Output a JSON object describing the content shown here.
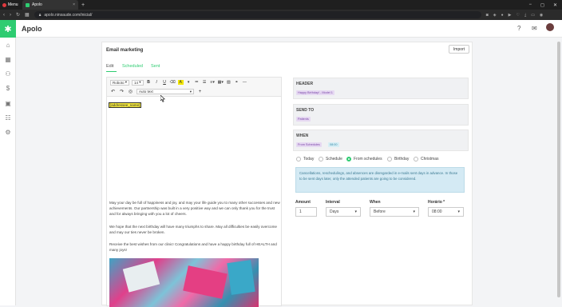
{
  "browser": {
    "menu_label": "Menu",
    "tab_title": "Apolo",
    "tab_close": "×",
    "new_tab": "+",
    "url": "apolo.ninsaude.com/inicial/",
    "window_controls": [
      "−",
      "◻",
      "✕"
    ]
  },
  "app": {
    "name": "Apolo",
    "logo_glyph": "✱",
    "sidebar_items": [
      "home-icon",
      "calendar-icon",
      "patients-icon",
      "finance-icon",
      "marketing-icon",
      "reports-icon",
      "settings-icon"
    ],
    "accent": "#2ecc71"
  },
  "card": {
    "title": "Email marketing",
    "import_label": "Import",
    "tabs": [
      {
        "label": "Edit"
      },
      {
        "label": "Scheduled"
      },
      {
        "label": "Sent"
      }
    ]
  },
  "editor": {
    "font": "Roboto",
    "size": "14",
    "bold": "B",
    "italic": "I",
    "underline": "U",
    "autotext_label": "Auto text",
    "add": "+",
    "placeholder_tag": "[addressee_name]",
    "paragraphs": [
      "May your day be full of happiness and joy, and may your life guide you to many other successes and new achievements. Our partnership was built in a very positive way and we can only thank you for the trust and for always bringing with you a lot of cheers.",
      "We hope that the next birthday will have many triumphs to share. May all difficulties be easily overcome and may our ties never be broken.",
      "Receive the best wishes from our clinic! Congratulations and have a happy birthday full of HEALTH and many joys!"
    ]
  },
  "settings": {
    "header": {
      "title": "HEADER",
      "tag": "Happy Birthday! - Model 1"
    },
    "send_to": {
      "title": "SEND TO",
      "tag": "Patients"
    },
    "when": {
      "title": "WHEN",
      "tag1": "From Schedules",
      "tag2": "08:00"
    },
    "radios": [
      {
        "label": "Today",
        "checked": false
      },
      {
        "label": "Schedule",
        "checked": false
      },
      {
        "label": "From schedules",
        "checked": true
      },
      {
        "label": "Birthday",
        "checked": false
      },
      {
        "label": "Christmas",
        "checked": false
      }
    ],
    "notice": "Cancellations, reschedulings, and absences are disregarded in e-mails sent days in advance. In those to be sent days later, only the attended patients are going to be considered.",
    "fields": {
      "amount": {
        "label": "Amount",
        "value": "1"
      },
      "interval": {
        "label": "Interval",
        "value": "Days"
      },
      "when": {
        "label": "When",
        "value": "Before"
      },
      "time": {
        "label": "Horário *",
        "value": "08:00"
      }
    }
  }
}
